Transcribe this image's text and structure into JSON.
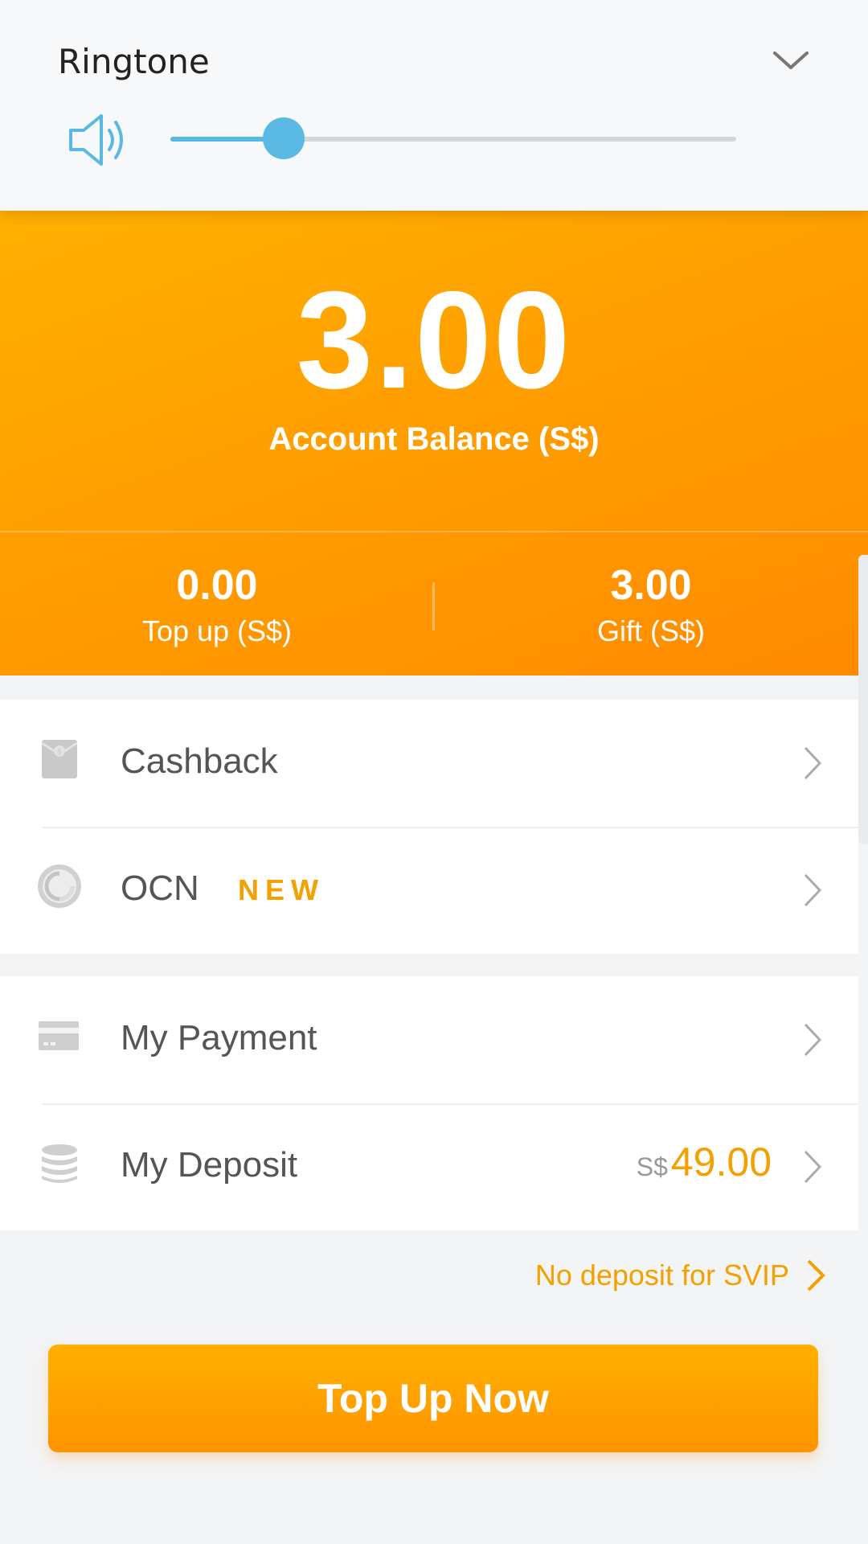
{
  "volume_panel": {
    "title": "Ringtone",
    "level": 0.2,
    "icons": {
      "speaker": "speaker-icon",
      "collapse": "chevron-down-icon"
    },
    "accent_color": "#5ab9e3"
  },
  "balance": {
    "amount": "3.00",
    "label": "Account Balance (S$)",
    "topup": {
      "value": "0.00",
      "label": "Top up (S$)"
    },
    "gift": {
      "value": "3.00",
      "label": "Gift (S$)"
    },
    "gradient_colors": [
      "#ffb000",
      "#ff8a00"
    ]
  },
  "menu": {
    "group1": [
      {
        "label": "Cashback",
        "icon": "cashback-envelope-icon"
      },
      {
        "label": "OCN",
        "icon": "ocn-icon",
        "badge": "NEW"
      }
    ],
    "group2": [
      {
        "label": "My Payment",
        "icon": "card-icon"
      },
      {
        "label": "My Deposit",
        "icon": "coin-stack-icon",
        "currency": "S$",
        "value": "49.00"
      }
    ]
  },
  "svip_link": "No deposit for SVIP",
  "topup_button": "Top Up Now",
  "accent_orange": "#f4a000"
}
